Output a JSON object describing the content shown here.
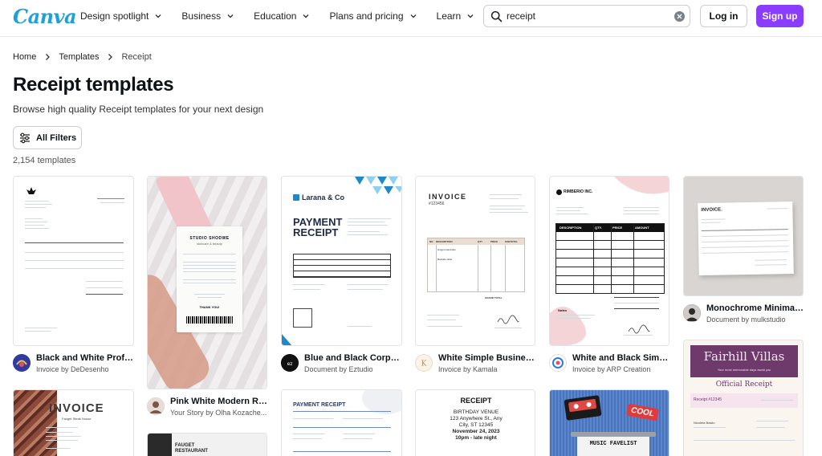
{
  "header": {
    "logo": "Canva",
    "nav": [
      {
        "label": "Design spotlight"
      },
      {
        "label": "Business"
      },
      {
        "label": "Education"
      },
      {
        "label": "Plans and pricing"
      },
      {
        "label": "Learn"
      }
    ],
    "search": {
      "value": "receipt"
    },
    "login_label": "Log in",
    "signup_label": "Sign up"
  },
  "breadcrumb": [
    "Home",
    "Templates",
    "Receipt"
  ],
  "page": {
    "title": "Receipt templates",
    "subtitle": "Browse high quality Receipt templates for your next design",
    "filters_label": "All Filters",
    "count": "2,154 templates"
  },
  "cards": [
    {
      "title": "Black and White Profes...",
      "author": "Invoice by DeDesenho"
    },
    {
      "title": "Pink White Modern Rec...",
      "author": "Your Story by Olha Kozache..."
    },
    {
      "title": "Blue and Black Corpor...",
      "author": "Document by Eztudio"
    },
    {
      "title": "White Simple Business ...",
      "author": "Invoice by Kamala"
    },
    {
      "title": "White and Black Simpl...",
      "author": "Invoice by ARP Creation"
    },
    {
      "title": "Monochrome Minimali...",
      "author": "Document by mulkstudio"
    }
  ],
  "thumbs": {
    "t2": {
      "brand": "STUDIO SHODWE",
      "sub": "skincare & beauty",
      "thanks": "THANK YOU!"
    },
    "t3": {
      "brand": "Larana & Co",
      "title1": "PAYMENT",
      "title2": "RECEIPT"
    },
    "t4": {
      "title": "INVOICE",
      "num": "#123456",
      "h1": "NO",
      "h2": "DESCRIPTION",
      "h3": "QTY",
      "h4": "PRICE",
      "h5": "SUBTOTAL",
      "r1": "Hinged wardrobe",
      "r2": "Bedside table",
      "total": "GRAND TOTAL"
    },
    "t5": {
      "brand": "RIMBERIO INC.",
      "c1": "DESCRIPTION",
      "c2": "QTY.",
      "c3": "PRICE",
      "c4": "AMOUNT",
      "notes": "Notes"
    },
    "t6": {
      "title": "INVOICE."
    },
    "b1": {
      "title": "INVOICE",
      "sub": "Fauget Steak House"
    },
    "b2": {
      "title": "FAUGET",
      "sub": "RESTAURANT"
    },
    "b3": {
      "title": "PAYMENT RECEIPT"
    },
    "b4": {
      "title": "RECEIPT",
      "l1": "BIRTHDAY VENUE",
      "l2": "123 Anywhere St., Any",
      "l3": "City, ST 12345",
      "l4": "November 24, 2023",
      "l5": "10pm - late night"
    },
    "b5": {
      "cool": "COOL",
      "music": "MUSIC FAVELIST"
    },
    "b6": {
      "title": "Fairhill Villas",
      "tag": "Your most memorable days await you",
      "sub": "Official Receipt",
      "num": "Receipt #12345",
      "name": "Nicoleta Basilo"
    }
  }
}
